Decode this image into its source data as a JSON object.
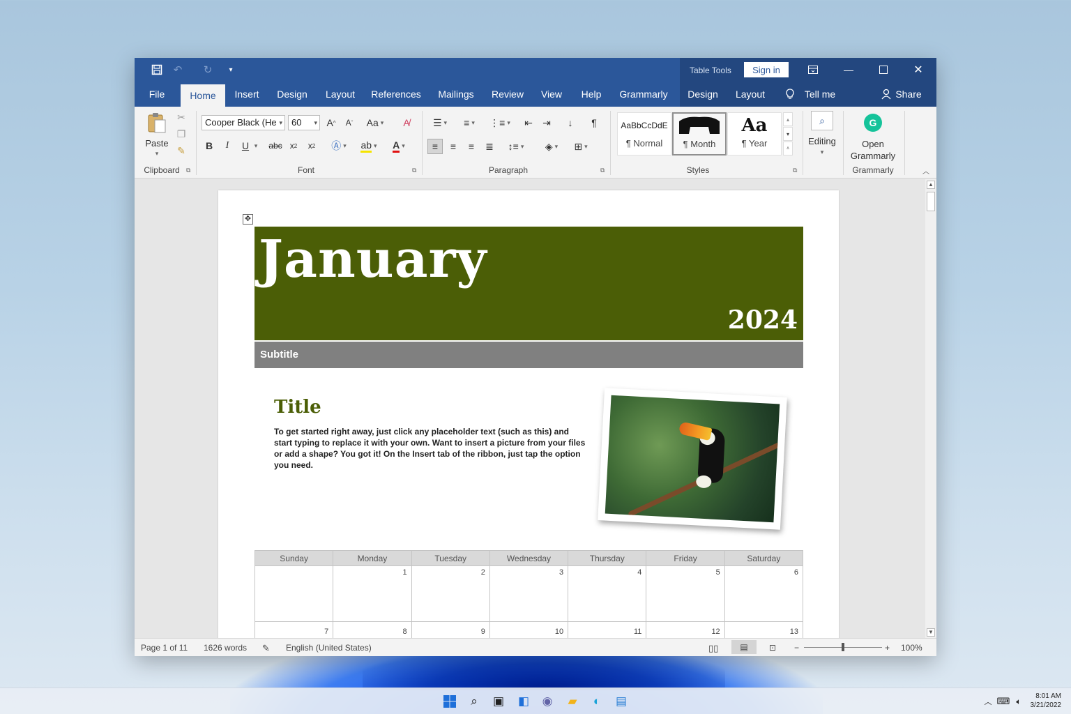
{
  "window": {
    "contextual_group": "Table Tools",
    "sign_in": "Sign in"
  },
  "tabs": [
    {
      "label": "File"
    },
    {
      "label": "Home"
    },
    {
      "label": "Insert"
    },
    {
      "label": "Design"
    },
    {
      "label": "Layout"
    },
    {
      "label": "References"
    },
    {
      "label": "Mailings"
    },
    {
      "label": "Review"
    },
    {
      "label": "View"
    },
    {
      "label": "Help"
    },
    {
      "label": "Grammarly"
    },
    {
      "label": "Design"
    },
    {
      "label": "Layout"
    }
  ],
  "tell_me": "Tell me",
  "share": "Share",
  "ribbon": {
    "clipboard": {
      "paste": "Paste",
      "label": "Clipboard"
    },
    "font": {
      "family": "Cooper Black (He",
      "size": "60",
      "change_case": "Aa",
      "bold": "B",
      "italic": "I",
      "underline": "U",
      "strikethrough": "abc",
      "label": "Font"
    },
    "paragraph": {
      "label": "Paragraph"
    },
    "styles": {
      "label": "Styles",
      "items": [
        {
          "preview": "AaBbCcDdE",
          "name": "¶ Normal"
        },
        {
          "preview": "",
          "name": "¶ Month"
        },
        {
          "preview": "Aa",
          "name": "¶ Year"
        }
      ]
    },
    "editing": {
      "label": "Editing"
    },
    "grammarly": {
      "open": "Open Grammarly",
      "label": "Grammarly"
    }
  },
  "document": {
    "month": "January",
    "year": "2024",
    "subtitle": "Subtitle",
    "title": "Title",
    "body": "To get started right away, just click any placeholder text (such as this) and start typing to replace it with your own. Want to insert a picture from your files or add a shape? You got it! On the Insert tab of the ribbon, just tap the option you need.",
    "calendar": {
      "days": [
        "Sunday",
        "Monday",
        "Tuesday",
        "Wednesday",
        "Thursday",
        "Friday",
        "Saturday"
      ],
      "week1": [
        "",
        "1",
        "2",
        "3",
        "4",
        "5",
        "6"
      ],
      "week2": [
        "7",
        "8",
        "9",
        "10",
        "11",
        "12",
        "13"
      ]
    }
  },
  "status": {
    "page": "Page 1 of 11",
    "words": "1626 words",
    "language": "English (United States)",
    "zoom": "100%"
  },
  "taskbar": {
    "time": "8:01 AM",
    "date": "3/21/2022"
  },
  "colors": {
    "word_blue": "#2b579a",
    "banner_green": "#4b5e06",
    "subtitle_gray": "#808080"
  }
}
